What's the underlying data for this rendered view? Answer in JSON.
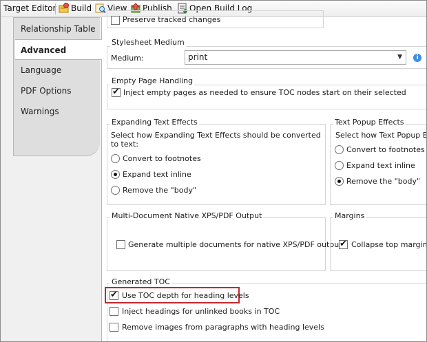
{
  "toolbar": {
    "target_editor": "Target Editor",
    "build": "Build",
    "view": "View",
    "publish": "Publish",
    "open_build_log": "Open Build Log"
  },
  "tabs": [
    {
      "label": "Relationship Table",
      "active": false
    },
    {
      "label": "Advanced",
      "active": true
    },
    {
      "label": "Language",
      "active": false
    },
    {
      "label": "PDF Options",
      "active": false
    },
    {
      "label": "Warnings",
      "active": false
    }
  ],
  "preserve": {
    "label": "Preserve tracked changes",
    "checked": false
  },
  "stylesheet": {
    "title": "Stylesheet Medium",
    "medium_label": "Medium:",
    "medium_value": "print"
  },
  "empty_page": {
    "title": "Empty Page Handling",
    "inject_label": "Inject empty pages as needed to ensure TOC nodes start on their selected",
    "checked": true
  },
  "expanding": {
    "title": "Expanding Text Effects",
    "description": "Select how Expanding Text Effects should be converted to text:",
    "options": [
      "Convert to footnotes",
      "Expand text inline",
      "Remove the \"body\""
    ],
    "selected": 1
  },
  "popup": {
    "title": "Text Popup Effects",
    "description": "Select how Text Popup Effe",
    "options": [
      "Convert to footnotes",
      "Expand text inline",
      "Remove the \"body\""
    ],
    "selected": 2
  },
  "multidoc": {
    "title": "Multi-Document Native XPS/PDF Output",
    "generate_label": "Generate multiple documents for native XPS/PDF output",
    "checked": false
  },
  "margins": {
    "title": "Margins",
    "collapse_label": "Collapse top margin at",
    "checked": true
  },
  "toc": {
    "title": "Generated TOC",
    "use_depth_label": "Use TOC depth for heading levels",
    "use_depth_checked": true,
    "inject_headings_label": "Inject headings for unlinked books in TOC",
    "inject_headings_checked": false,
    "remove_images_label": "Remove images from paragraphs with heading levels",
    "remove_images_checked": false
  },
  "colors": {
    "highlight": "#c0282c",
    "info_icon": "#3d8fe0"
  }
}
